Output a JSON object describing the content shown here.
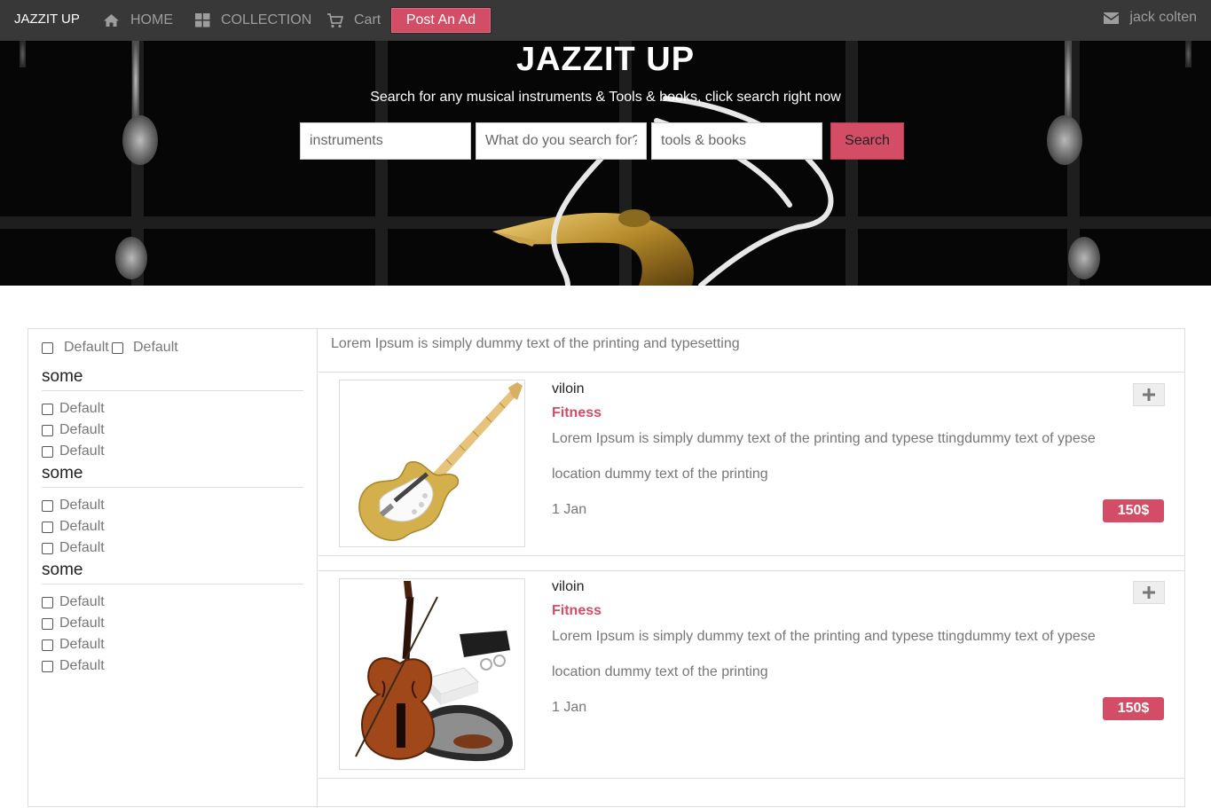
{
  "navbar": {
    "brand": "JAZZIT UP",
    "home_label": "HOME",
    "home_icon": "home-icon",
    "collection_label": "COLLECTION",
    "collection_icon": "grid-icon",
    "cart_label": "Cart",
    "cart_icon": "cart-icon",
    "post_ad_label": "Post An Ad",
    "user_name": "jack colten",
    "user_icon": "envelope-icon"
  },
  "hero": {
    "title": "JAZZIT UP",
    "subtitle": "Search for any musical instruments & Tools & books, click search right now",
    "category_placeholder": "instruments",
    "query_placeholder": "What do you search for?",
    "tools_placeholder": "tools & books",
    "search_label": "Search"
  },
  "sidebar": {
    "top_options": [
      "Default",
      "Default"
    ],
    "sections": [
      {
        "title": "some",
        "options": [
          "Default",
          "Default",
          "Default"
        ]
      },
      {
        "title": "some",
        "options": [
          "Default",
          "Default",
          "Default"
        ]
      },
      {
        "title": "some",
        "options": [
          "Default",
          "Default",
          "Default",
          "Default"
        ]
      }
    ]
  },
  "main": {
    "intro": "Lorem Ipsum is simply dummy text of the printing and typesetting",
    "listings": [
      {
        "title": "viloin",
        "category": "Fitness",
        "description": "Lorem Ipsum is simply dummy text of the printing and typese ttingdummy text of ypese",
        "location": "location dummy text of the printing",
        "date": "1 Jan",
        "price": "150$",
        "image": "electric-guitar-image"
      },
      {
        "title": "viloin",
        "category": "Fitness",
        "description": "Lorem Ipsum is simply dummy text of the printing and typese ttingdummy text of ypese",
        "location": "location dummy text of the printing",
        "date": "1 Jan",
        "price": "150$",
        "image": "violin-kit-image"
      }
    ]
  },
  "colors": {
    "navbar_bg": "#383838",
    "accent": "#d24d65",
    "muted_text": "#777777"
  }
}
